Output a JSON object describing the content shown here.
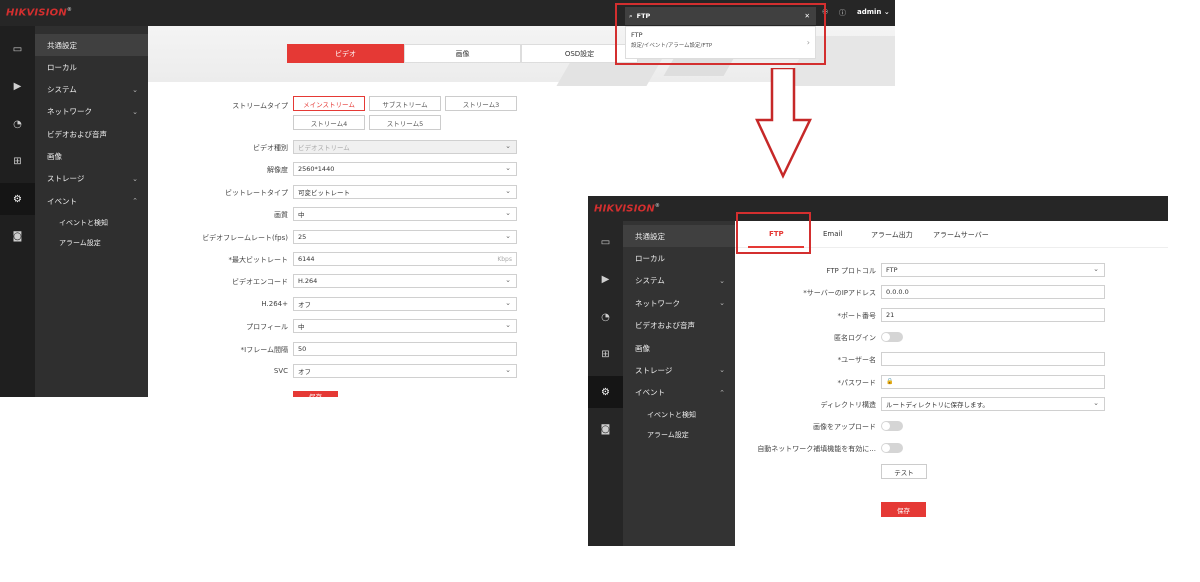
{
  "brand": {
    "logo": "HIKVISION",
    "reg": "®"
  },
  "colors": {
    "accent": "#e53935",
    "dark_bg": "#262626",
    "menu_bg": "#2f2f2f"
  },
  "menu": {
    "items": [
      {
        "label": "共通設定",
        "chevron": false
      },
      {
        "label": "ローカル",
        "chevron": false
      },
      {
        "label": "システム",
        "chevron": true
      },
      {
        "label": "ネットワーク",
        "chevron": true
      },
      {
        "label": "ビデオおよび音声",
        "chevron": false
      },
      {
        "label": "画像",
        "chevron": false
      },
      {
        "label": "ストレージ",
        "chevron": true
      },
      {
        "label": "イベント",
        "chevron": true
      }
    ],
    "subitems": [
      "イベントと検知",
      "アラーム設定"
    ]
  },
  "icons": [
    "monitor-icon",
    "playback-icon",
    "ptz-icon",
    "apps-icon",
    "gear-icon",
    "camera-icon"
  ],
  "win1": {
    "header": {
      "user": "admin",
      "chevron": "⌄"
    },
    "search": {
      "query": "FTP",
      "result_title": "FTP",
      "result_path": "設定/イベント/アラーム設定/FTP",
      "close": "✕"
    },
    "tabs": [
      "ビデオ",
      "画像",
      "OSD設定"
    ],
    "stream": {
      "label": "ストリームタイプ",
      "options": [
        "メインストリーム",
        "サブストリーム",
        "ストリーム3",
        "ストリーム4",
        "ストリーム5"
      ]
    },
    "fields": [
      {
        "label": "ビデオ種別",
        "value": "ビデオストリーム",
        "type": "select-disabled"
      },
      {
        "label": "解像度",
        "value": "2560*1440",
        "type": "select"
      },
      {
        "label": "ビットレートタイプ",
        "value": "可変ビットレート",
        "type": "select"
      },
      {
        "label": "画質",
        "value": "中",
        "type": "select"
      },
      {
        "label": "ビデオフレームレート(fps)",
        "value": "25",
        "type": "select"
      },
      {
        "label": "*最大ビットレート",
        "value": "6144",
        "type": "text",
        "unit": "Kbps"
      },
      {
        "label": "ビデオエンコード",
        "value": "H.264",
        "type": "select"
      },
      {
        "label": "H.264+",
        "value": "オフ",
        "type": "select"
      },
      {
        "label": "プロフィール",
        "value": "中",
        "type": "select"
      },
      {
        "label": "*Iフレーム間隔",
        "value": "50",
        "type": "text"
      },
      {
        "label": "SVC",
        "value": "オフ",
        "type": "select"
      }
    ],
    "save_label": "保存"
  },
  "win2": {
    "tabs": [
      "FTP",
      "Email",
      "アラーム出力",
      "アラームサーバー"
    ],
    "fields": [
      {
        "label": "FTP プロトコル",
        "value": "FTP",
        "type": "select"
      },
      {
        "label": "*サーバーのIPアドレス",
        "value": "0.0.0.0",
        "type": "text"
      },
      {
        "label": "*ポート番号",
        "value": "21",
        "type": "text"
      },
      {
        "label": "匿名ログイン",
        "type": "toggle"
      },
      {
        "label": "*ユーザー名",
        "value": "",
        "type": "text"
      },
      {
        "label": "*パスワード",
        "value": "",
        "type": "password"
      },
      {
        "label": "ディレクトリ構造",
        "value": "ルートディレクトリに保存します。",
        "type": "select"
      },
      {
        "label": "画像をアップロード",
        "type": "toggle"
      },
      {
        "label": "自動ネットワーク補填機能を有効に...",
        "type": "toggle"
      }
    ],
    "test_label": "テスト",
    "save_label": "保存"
  }
}
